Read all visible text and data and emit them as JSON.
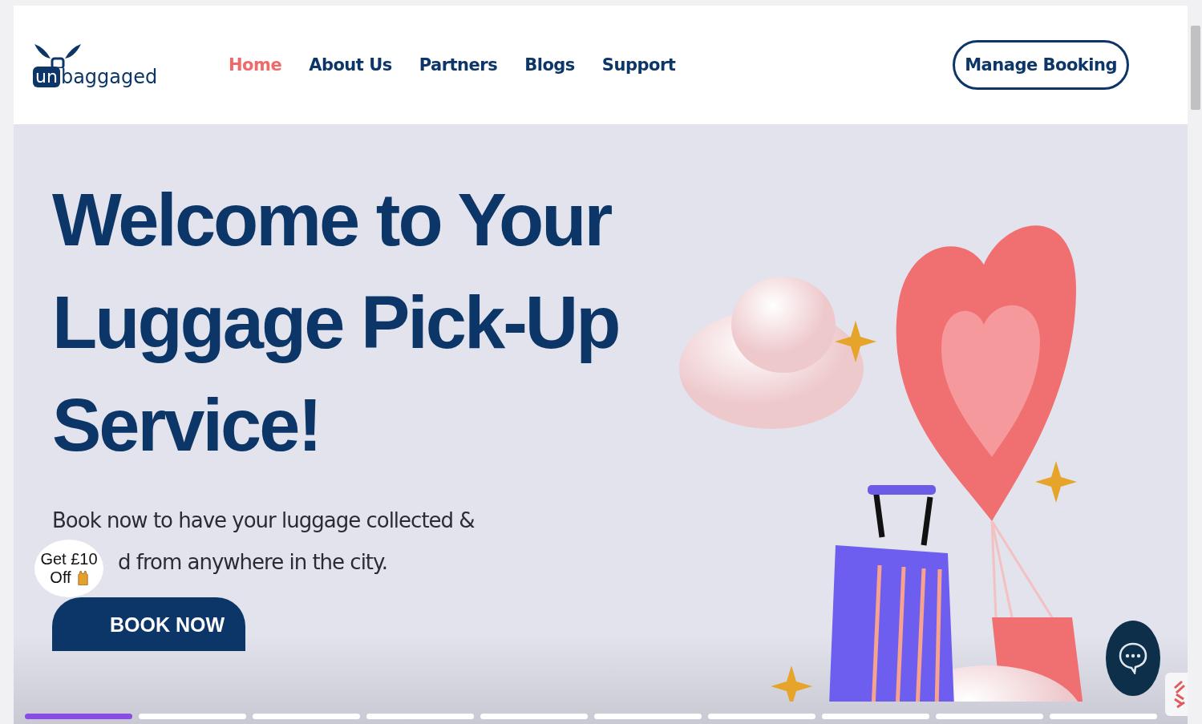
{
  "header": {
    "logo": {
      "badge": "un",
      "text": "baggaged"
    },
    "nav": [
      {
        "label": "Home",
        "selected": true
      },
      {
        "label": "About Us",
        "selected": false
      },
      {
        "label": "Partners",
        "selected": false
      },
      {
        "label": "Blogs",
        "selected": false
      },
      {
        "label": "Support",
        "selected": false
      }
    ],
    "manage_button": "Manage Booking"
  },
  "hero": {
    "title_lines": [
      "Welcome to Your",
      "Luggage Pick-Up",
      "Service!"
    ],
    "text_lines": [
      "Book now to have your luggage collected &",
      "d from anywhere in the city."
    ],
    "cta": "BOOK NOW"
  },
  "promo_badge": {
    "line1": "Get £10",
    "line2": "Off"
  },
  "slides": [
    {
      "selected": true
    },
    {
      "selected": false
    },
    {
      "selected": false
    },
    {
      "selected": false
    },
    {
      "selected": false
    },
    {
      "selected": false
    },
    {
      "selected": false
    },
    {
      "selected": false
    },
    {
      "selected": false
    },
    {
      "selected": false
    }
  ]
}
